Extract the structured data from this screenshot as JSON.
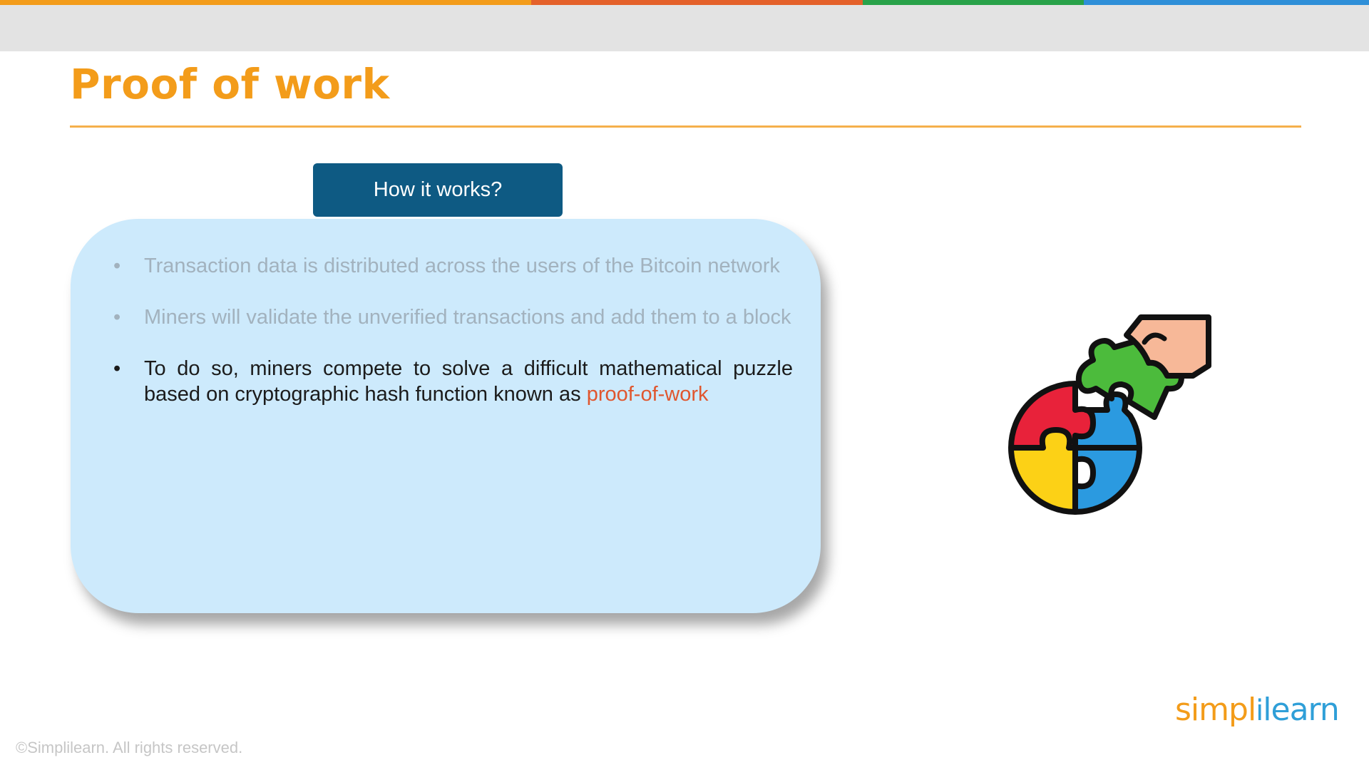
{
  "slide": {
    "title": "Proof of work",
    "badge_label": "How it works?",
    "bullets": {
      "b1": "Transaction data is distributed across the users of the Bitcoin network",
      "b2": "Miners will validate the unverified transactions and add them to a block",
      "b3_text": "To do so, miners compete to solve a difficult mathematical puzzle based on cryptographic hash function known as",
      "b3_highlight": "proof-of-work"
    },
    "bullet_glyph": "•"
  },
  "illustration": {
    "icon": "puzzle-hand-icon"
  },
  "branding": {
    "logo_part1": "simpl",
    "logo_sep": "i",
    "logo_part2": "learn",
    "copyright": "©Simplilearn. All rights reserved."
  },
  "colors": {
    "title": "#f39c1a",
    "badge": "#0e5a83",
    "card": "#cdeafc",
    "highlight": "#e0562e",
    "stripe": [
      "#f39c1a",
      "#e4612a",
      "#29a24a",
      "#2f8fd8"
    ]
  }
}
